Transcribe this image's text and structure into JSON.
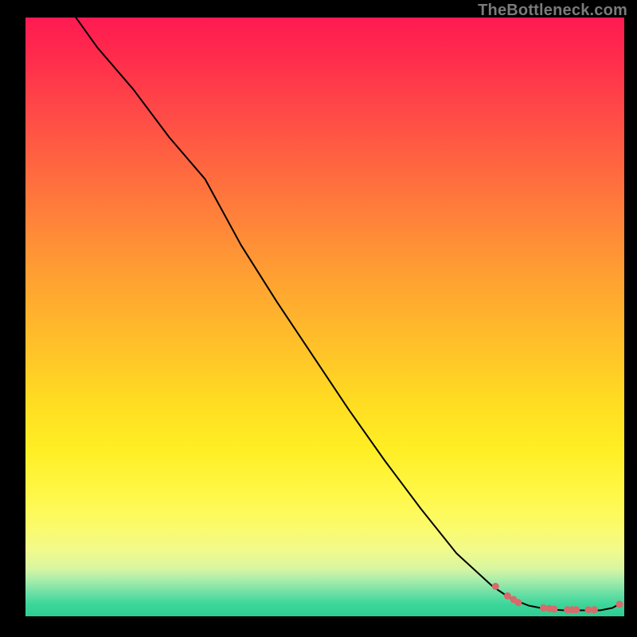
{
  "watermark": "TheBottleneck.com",
  "chart_data": {
    "type": "line",
    "title": "",
    "xlabel": "",
    "ylabel": "",
    "xlim": [
      0,
      100
    ],
    "ylim": [
      0,
      100
    ],
    "grid": false,
    "series": [
      {
        "name": "curve",
        "color": "#000000",
        "stroke_width": 2,
        "x": [
          7,
          12,
          18,
          24,
          30,
          36,
          42,
          48,
          54,
          60,
          66,
          72,
          78,
          81,
          84,
          87,
          90,
          93,
          96,
          98,
          99.5
        ],
        "values": [
          102,
          95,
          88,
          80,
          73,
          62,
          52.5,
          43.5,
          34.5,
          26,
          18,
          10.5,
          5,
          3,
          1.8,
          1.2,
          1.0,
          1.0,
          1.0,
          1.4,
          2.2
        ]
      },
      {
        "name": "points",
        "type": "scatter",
        "color": "#d86a6a",
        "x": [
          78.5,
          80.5,
          81.5,
          82.3,
          86.5,
          87.5,
          88.3,
          90.5,
          91.3,
          92.0,
          94.0,
          95.0,
          99.2
        ],
        "values": [
          5.0,
          3.4,
          2.8,
          2.3,
          1.4,
          1.3,
          1.2,
          1.1,
          1.1,
          1.1,
          1.1,
          1.1,
          2.0
        ]
      }
    ],
    "gradient_stops": [
      {
        "pos": 0.0,
        "color": "#ff1a52"
      },
      {
        "pos": 0.3,
        "color": "#ff7a3c"
      },
      {
        "pos": 0.6,
        "color": "#ffd424"
      },
      {
        "pos": 0.85,
        "color": "#f6fa82"
      },
      {
        "pos": 1.0,
        "color": "#2fcd91"
      }
    ]
  }
}
